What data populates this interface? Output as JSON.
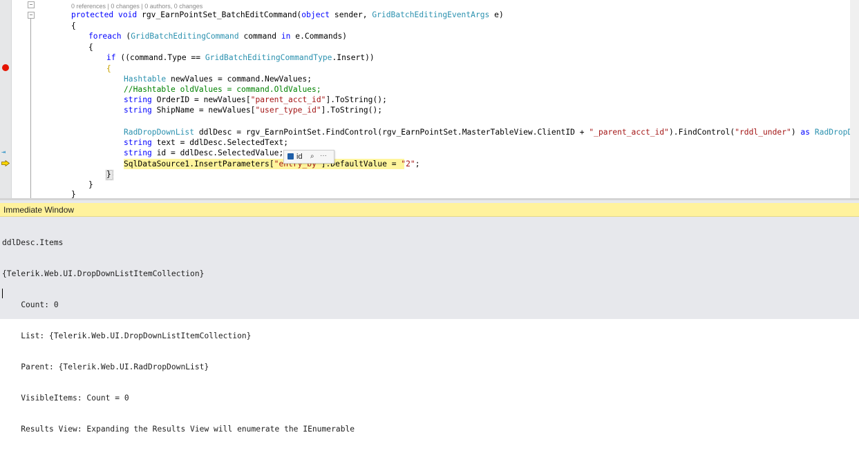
{
  "editor": {
    "codelens": "0 references | 0 changes | 0 authors, 0 changes",
    "line_method": [
      {
        "text": "protected",
        "cls": "kw"
      },
      {
        "text": " ",
        "cls": "pl"
      },
      {
        "text": "void",
        "cls": "kw"
      },
      {
        "text": " rgv_EarnPointSet_BatchEditCommand(",
        "cls": "pl"
      },
      {
        "text": "object",
        "cls": "kw"
      },
      {
        "text": " sender, ",
        "cls": "pl"
      },
      {
        "text": "GridBatchEditingEventArgs",
        "cls": "ty"
      },
      {
        "text": " e)",
        "cls": "pl"
      }
    ],
    "brace_open": "{",
    "brace_close": "}",
    "line_foreach": [
      {
        "text": "foreach",
        "cls": "kw"
      },
      {
        "text": " (",
        "cls": "pl"
      },
      {
        "text": "GridBatchEditingCommand",
        "cls": "ty"
      },
      {
        "text": " command ",
        "cls": "pl"
      },
      {
        "text": "in",
        "cls": "kw"
      },
      {
        "text": " e.Commands)",
        "cls": "pl"
      }
    ],
    "line_if": [
      {
        "text": "if",
        "cls": "kw"
      },
      {
        "text": " ((command.Type == ",
        "cls": "pl"
      },
      {
        "text": "GridBatchEditingCommandType",
        "cls": "ty"
      },
      {
        "text": ".Insert))",
        "cls": "pl"
      }
    ],
    "line_hashtable": [
      {
        "text": "Hashtable",
        "cls": "ty"
      },
      {
        "text": " newValues = command.NewValues;",
        "cls": "pl"
      }
    ],
    "line_comment": "//Hashtable oldValues = command.OldValues;",
    "line_orderid": [
      {
        "text": "string",
        "cls": "kw"
      },
      {
        "text": " OrderID = newValues[",
        "cls": "pl"
      },
      {
        "text": "\"parent_acct_id\"",
        "cls": "st"
      },
      {
        "text": "].ToString();",
        "cls": "pl"
      }
    ],
    "line_shipname": [
      {
        "text": "string",
        "cls": "kw"
      },
      {
        "text": " ShipName = newValues[",
        "cls": "pl"
      },
      {
        "text": "\"user_type_id\"",
        "cls": "st"
      },
      {
        "text": "].ToString();",
        "cls": "pl"
      }
    ],
    "line_ddl": [
      {
        "text": "RadDropDownList",
        "cls": "ty"
      },
      {
        "text": " ddlDesc = rgv_EarnPointSet.FindControl(rgv_EarnPointSet.MasterTableView.ClientID + ",
        "cls": "pl"
      },
      {
        "text": "\"_parent_acct_id\"",
        "cls": "st"
      },
      {
        "text": ").FindControl(",
        "cls": "pl"
      },
      {
        "text": "\"rddl_under\"",
        "cls": "st"
      },
      {
        "text": ") ",
        "cls": "pl"
      },
      {
        "text": "as",
        "cls": "kw"
      },
      {
        "text": " ",
        "cls": "pl"
      },
      {
        "text": "RadDropDownList",
        "cls": "ty"
      },
      {
        "text": ";",
        "cls": "pl"
      }
    ],
    "line_text": [
      {
        "text": "string",
        "cls": "kw"
      },
      {
        "text": " text = ddlDesc.SelectedText;",
        "cls": "pl"
      }
    ],
    "line_id": [
      {
        "text": "string",
        "cls": "kw"
      },
      {
        "text": " id = ddlDesc.SelectedValue;",
        "cls": "pl"
      }
    ],
    "line_sql": [
      {
        "text": "SqlDataSource1.InsertParameters[",
        "cls": "pl"
      },
      {
        "text": "\"entry_by\"",
        "cls": "st"
      },
      {
        "text": "].DefaultValue = ",
        "cls": "pl"
      },
      {
        "text": "\"2\"",
        "cls": "st"
      },
      {
        "text": ";",
        "cls": "pl"
      }
    ],
    "datatip": {
      "name": "id",
      "pin_icon": "magnifier-pin-icon",
      "more": "···"
    }
  },
  "immediate": {
    "title": "Immediate Window",
    "lines": [
      "ddlDesc.Items",
      "{Telerik.Web.UI.DropDownListItemCollection}",
      "    Count: 0",
      "    List: {Telerik.Web.UI.DropDownListItemCollection}",
      "    Parent: {Telerik.Web.UI.RadDropDownList}",
      "    VisibleItems: Count = 0",
      "    Results View: Expanding the Results View will enumerate the IEnumerable"
    ]
  },
  "colors": {
    "keyword": "#0000ff",
    "type": "#2b91af",
    "string": "#a31515",
    "comment": "#008000",
    "current_statement": "#fff59d",
    "breakpoint": "#e51400",
    "immediate_title": "#fff29d"
  }
}
